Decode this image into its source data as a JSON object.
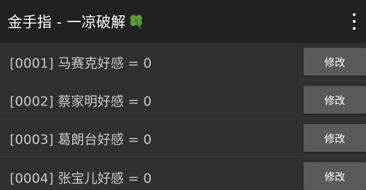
{
  "toolbar": {
    "title": "金手指 - 一凉破解",
    "title_icon": "four-leaf-clover-icon",
    "menu_icon": "more-vert-icon"
  },
  "rows": [
    {
      "label": "[0001] 马赛克好感 = 0",
      "button": "修改"
    },
    {
      "label": "[0002] 蔡家明好感 = 0",
      "button": "修改"
    },
    {
      "label": "[0003] 葛朗台好感 = 0",
      "button": "修改"
    },
    {
      "label": "[0004] 张宝儿好感 = 0",
      "button": "修改"
    }
  ],
  "colors": {
    "toolbar_bg": "#212121",
    "list_bg": "#303030",
    "button_bg": "#5a5a5a",
    "clover": "#5a9e3c"
  }
}
